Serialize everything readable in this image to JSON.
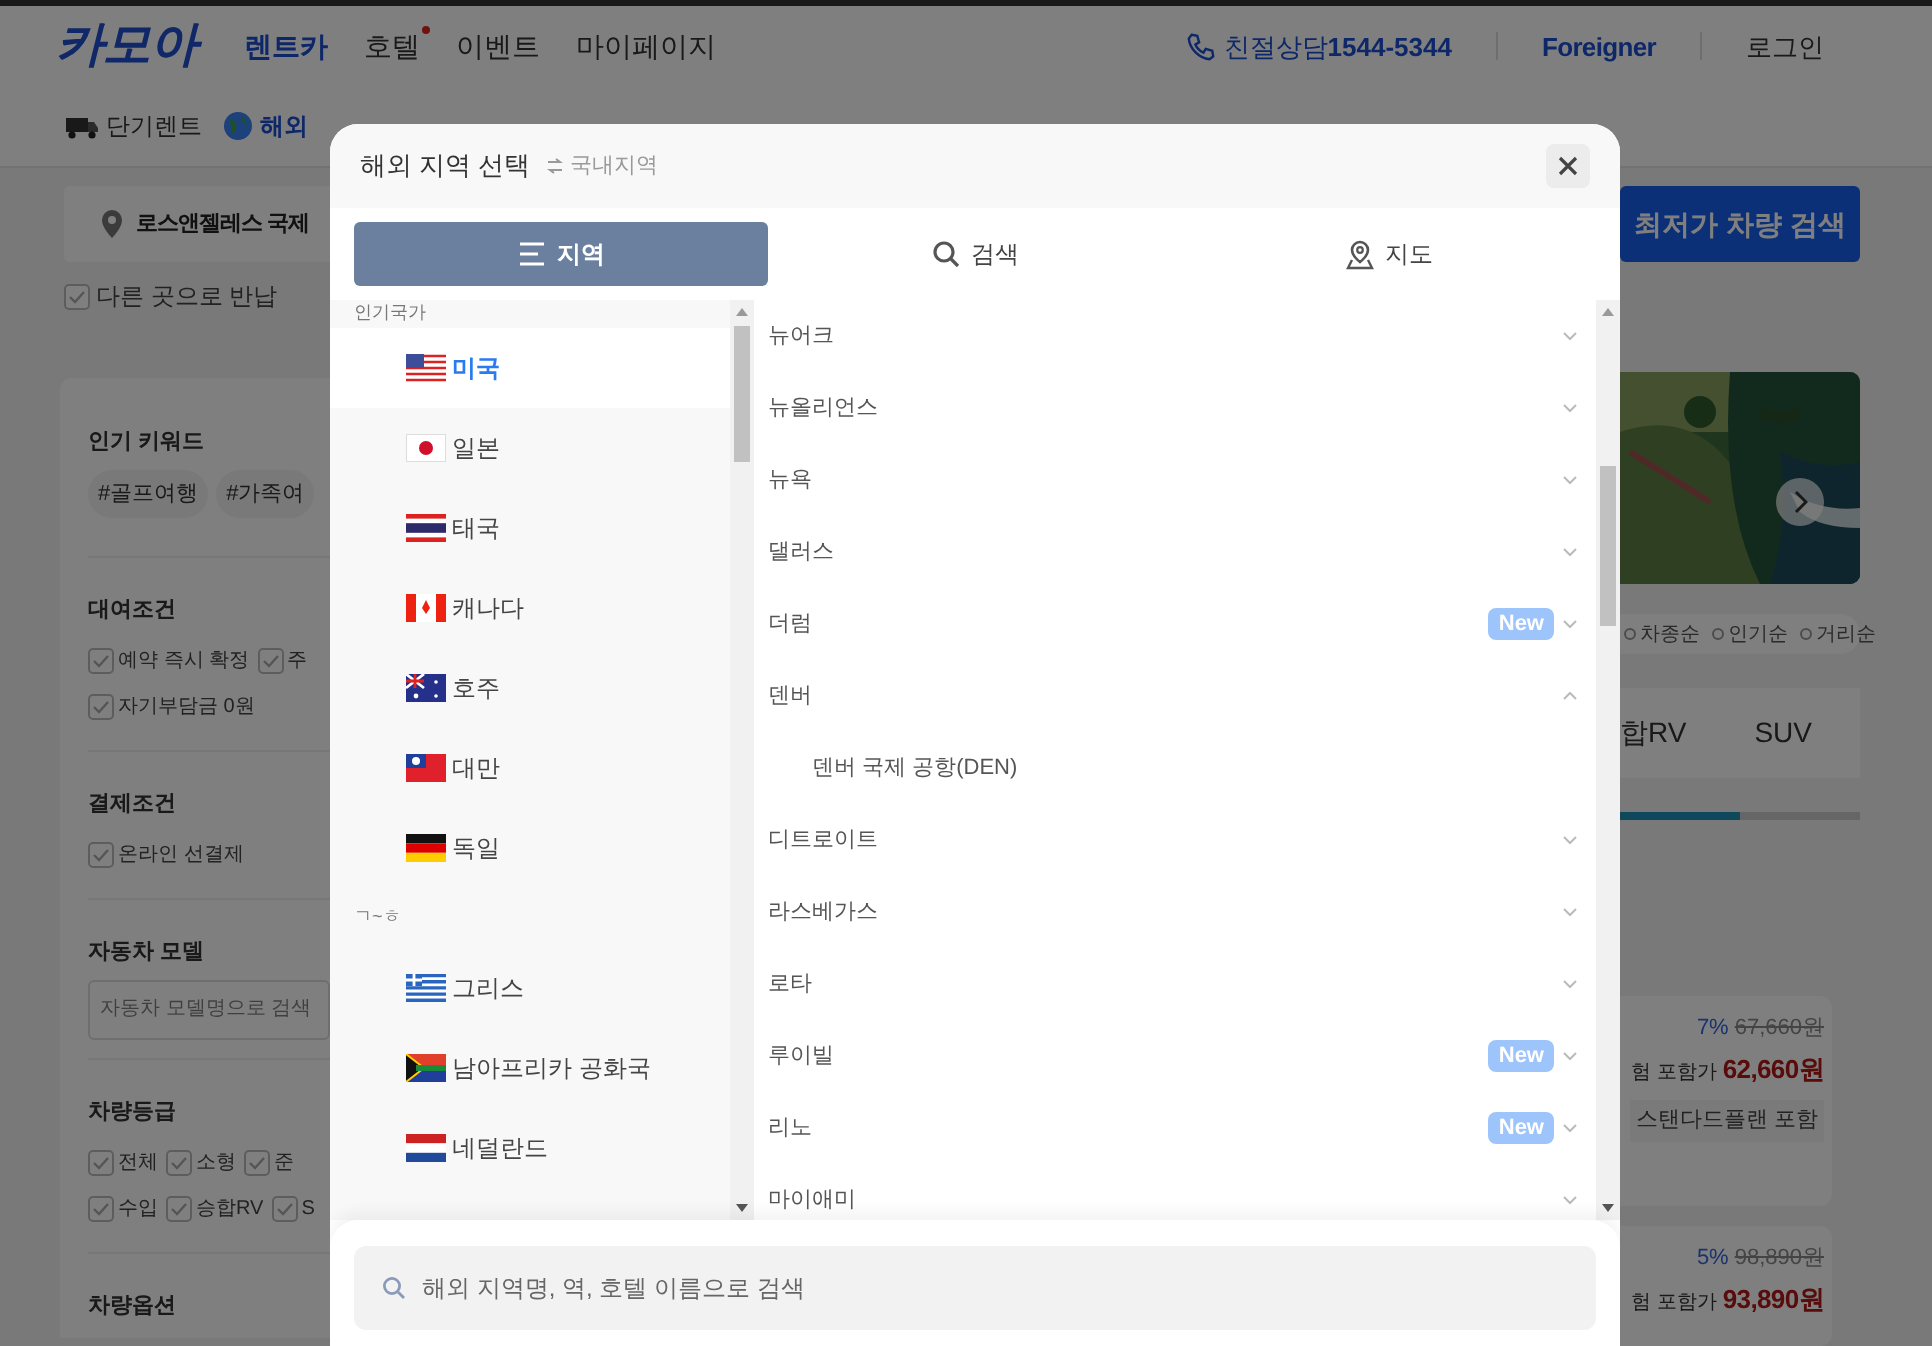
{
  "header": {
    "logo": "카모아",
    "nav": [
      {
        "label": "렌트카",
        "selected": true,
        "dot": false
      },
      {
        "label": "호텔",
        "selected": false,
        "dot": true
      },
      {
        "label": "이벤트",
        "selected": false,
        "dot": false
      },
      {
        "label": "마이페이지",
        "selected": false,
        "dot": false
      }
    ],
    "phone_label": "친절상담",
    "phone": "1544-5344",
    "foreigner": "Foreigner",
    "login": "로그인"
  },
  "service_tabs": [
    {
      "label": "단기렌트",
      "selected": false
    },
    {
      "label": "해외",
      "selected": true
    }
  ],
  "search_bar": {
    "location": "로스앤젤레스 국제",
    "button": "최저가 차량 검색"
  },
  "return_option": {
    "label": "다른 곳으로 반납",
    "checked": false
  },
  "filters": [
    {
      "title": "인기 키워드",
      "kind": "chips",
      "items": [
        "#골프여행",
        "#가족여"
      ]
    },
    {
      "title": "대여조건",
      "kind": "checks",
      "rows": [
        [
          {
            "label": "예약 즉시 확정",
            "checked": false
          },
          {
            "label": "주",
            "checked": false
          }
        ],
        [
          {
            "label": "자기부담금 0원",
            "checked": false
          }
        ]
      ]
    },
    {
      "title": "결제조건",
      "kind": "checks",
      "rows": [
        [
          {
            "label": "온라인 선결제",
            "checked": false
          }
        ]
      ]
    },
    {
      "title": "자동차 모델",
      "kind": "field",
      "placeholder": "자동차 모델명으로 검색"
    },
    {
      "title": "차량등급",
      "kind": "checks",
      "rows": [
        [
          {
            "label": "전체",
            "checked": false
          },
          {
            "label": "소형",
            "checked": false
          },
          {
            "label": "준",
            "checked": false
          }
        ],
        [
          {
            "label": "수입",
            "checked": false
          },
          {
            "label": "승합RV",
            "checked": false
          },
          {
            "label": "S",
            "checked": false
          }
        ]
      ]
    },
    {
      "title": "차량옵션",
      "kind": "title"
    }
  ],
  "sort_options": [
    "차종순",
    "인기순",
    "거리순"
  ],
  "class_tabs": [
    "합RV",
    "SUV"
  ],
  "class_progress": {
    "level": 0.5
  },
  "results": [
    {
      "discount": "7%",
      "original_price": "67,660원",
      "price_label": "험 포함가",
      "price": "62,660원",
      "plan": "스탠다드플랜 포함"
    },
    {
      "discount": "5%",
      "original_price": "98,890원",
      "price_label": "험 포함가",
      "price": "93,890원"
    }
  ],
  "modal": {
    "title": "해외 지역 선택",
    "switch_link": "국내지역",
    "tabs": [
      {
        "label": "지역",
        "selected": true
      },
      {
        "label": "검색",
        "selected": false
      },
      {
        "label": "지도",
        "selected": false
      }
    ],
    "country_groups": [
      {
        "group": "인기국가",
        "items": [
          {
            "name": "미국",
            "selected": true
          },
          {
            "name": "일본",
            "selected": false
          },
          {
            "name": "태국",
            "selected": false
          },
          {
            "name": "캐나다",
            "selected": false
          },
          {
            "name": "호주",
            "selected": false
          },
          {
            "name": "대만",
            "selected": false
          },
          {
            "name": "독일",
            "selected": false
          }
        ]
      },
      {
        "group": "ㄱ~ㅎ",
        "items": [
          {
            "name": "그리스",
            "selected": false
          },
          {
            "name": "남아프리카 공화국",
            "selected": false
          },
          {
            "name": "네덜란드",
            "selected": false
          }
        ]
      }
    ],
    "cities": [
      {
        "name": "뉴어크",
        "expanded": false
      },
      {
        "name": "뉴올리언스",
        "expanded": false
      },
      {
        "name": "뉴욕",
        "expanded": false
      },
      {
        "name": "댈러스",
        "expanded": false
      },
      {
        "name": "더럼",
        "badge": "New",
        "expanded": false
      },
      {
        "name": "덴버",
        "expanded": true,
        "children": [
          "덴버 국제 공항(DEN)"
        ]
      },
      {
        "name": "디트로이트",
        "expanded": false
      },
      {
        "name": "라스베가스",
        "expanded": false
      },
      {
        "name": "로타",
        "expanded": false
      },
      {
        "name": "루이빌",
        "badge": "New",
        "expanded": false
      },
      {
        "name": "리노",
        "badge": "New",
        "expanded": false
      },
      {
        "name": "마이애미",
        "expanded": false
      }
    ],
    "search_placeholder": "해외 지역명, 역, 호텔 이름으로 검색"
  }
}
